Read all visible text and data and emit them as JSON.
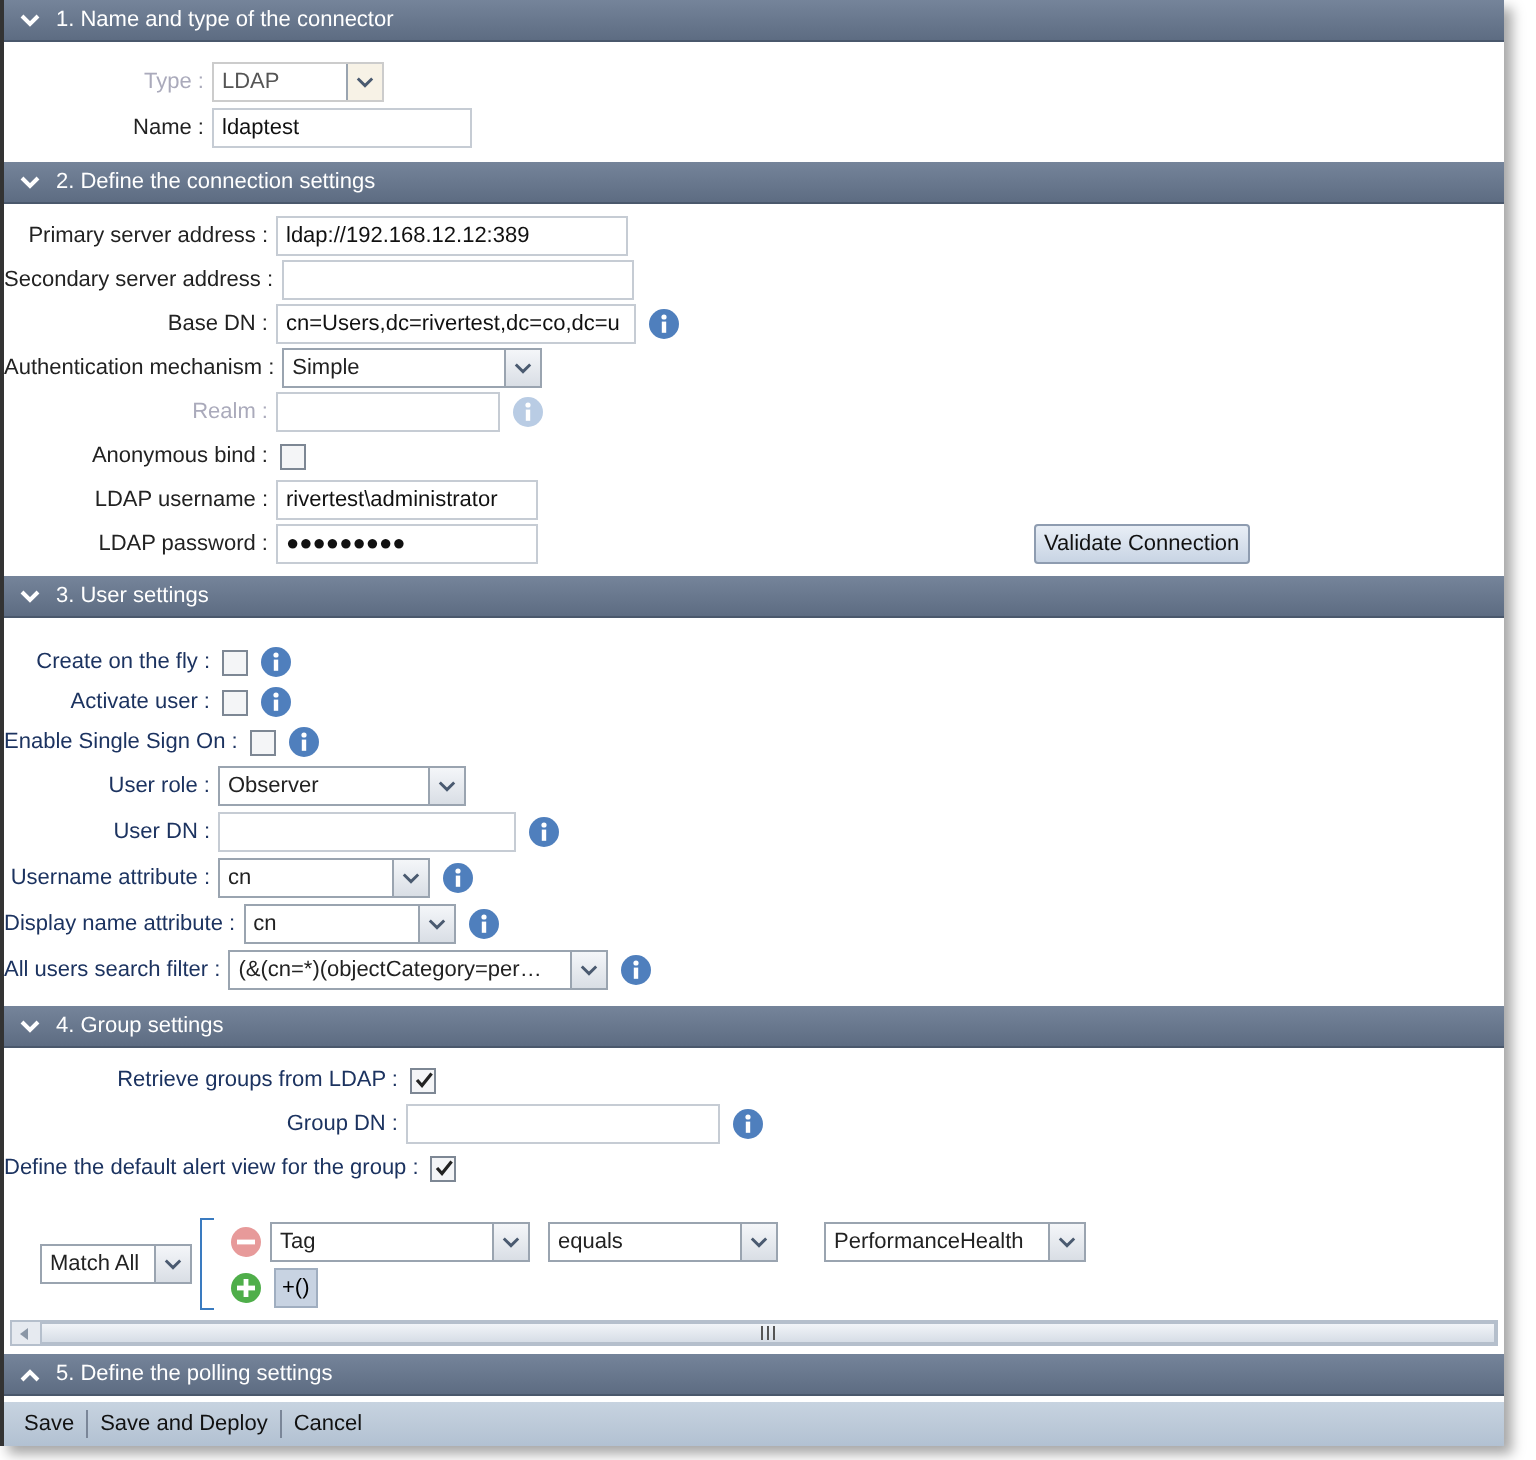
{
  "sections": [
    {
      "title": "1. Name and type of the connector",
      "expanded": true,
      "fields": [
        {
          "kind": "select",
          "label": "Type :",
          "value": "LDAP",
          "disabled": true,
          "info": false
        },
        {
          "kind": "text",
          "label": "Name :",
          "value": "ldaptest",
          "disabled": false,
          "info": false
        }
      ]
    },
    {
      "title": "2. Define the connection settings",
      "expanded": true,
      "button": "Validate Connection",
      "fields": [
        {
          "kind": "text",
          "label": "Primary server address :",
          "value": "ldap://192.168.12.12:389",
          "disabled": false,
          "info": false
        },
        {
          "kind": "text",
          "label": "Secondary server address :",
          "disabled": false,
          "info": false
        },
        {
          "kind": "text",
          "label": "Base DN :",
          "value": "cn=Users,dc=rivertest,dc=co,dc=u",
          "disabled": false,
          "info": true
        },
        {
          "kind": "select",
          "label": "Authentication mechanism :",
          "value": "Simple",
          "disabled": false,
          "info": false
        },
        {
          "kind": "text",
          "label": "Realm :",
          "disabled": true,
          "info": true
        },
        {
          "kind": "checkbox",
          "label": "Anonymous bind :",
          "checked": false,
          "disabled": false,
          "info": false
        },
        {
          "kind": "text",
          "label": "LDAP username :",
          "value": "rivertest\\administrator",
          "disabled": false,
          "info": false
        },
        {
          "kind": "text",
          "label": "LDAP password :",
          "value": "●●●●●●●●●",
          "disabled": false,
          "info": false
        }
      ]
    },
    {
      "title": "3. User settings",
      "expanded": true,
      "fields": [
        {
          "kind": "checkbox",
          "label": "Create on the fly :",
          "checked": false,
          "disabled": false,
          "info": true
        },
        {
          "kind": "checkbox",
          "label": "Activate user :",
          "checked": false,
          "disabled": false,
          "info": true
        },
        {
          "kind": "checkbox",
          "label": "Enable Single Sign On :",
          "checked": false,
          "disabled": false,
          "info": true
        },
        {
          "kind": "select",
          "label": "User role :",
          "value": "Observer",
          "disabled": false,
          "info": false
        },
        {
          "kind": "text",
          "label": "User DN :",
          "disabled": false,
          "info": true
        },
        {
          "kind": "select",
          "label": "Username attribute :",
          "value": "cn",
          "disabled": false,
          "info": true
        },
        {
          "kind": "select",
          "label": "Display name attribute :",
          "value": "cn",
          "disabled": false,
          "info": true
        },
        {
          "kind": "select",
          "label": "All users search filter :",
          "value": "(&(cn=*)(objectCategory=per…",
          "disabled": false,
          "info": true
        }
      ]
    },
    {
      "title": "4. Group settings",
      "expanded": true,
      "fields": [
        {
          "kind": "checkbox",
          "label": "Retrieve groups from LDAP :",
          "checked": true,
          "disabled": false,
          "info": false
        },
        {
          "kind": "text",
          "label": "Group DN :",
          "disabled": false,
          "info": true
        },
        {
          "kind": "checkbox",
          "label": "Define the default alert view for the group :",
          "checked": true,
          "disabled": false,
          "info": false
        }
      ],
      "filter": {
        "match": "Match All",
        "rules": [
          {
            "field": "Tag",
            "operator": "equals",
            "value": "PerformanceHealth"
          }
        ],
        "group_button": "+()"
      }
    },
    {
      "title": "5. Define the polling settings",
      "expanded": false
    }
  ],
  "toolbar": [
    "Save",
    "Save and Deploy",
    "Cancel"
  ]
}
